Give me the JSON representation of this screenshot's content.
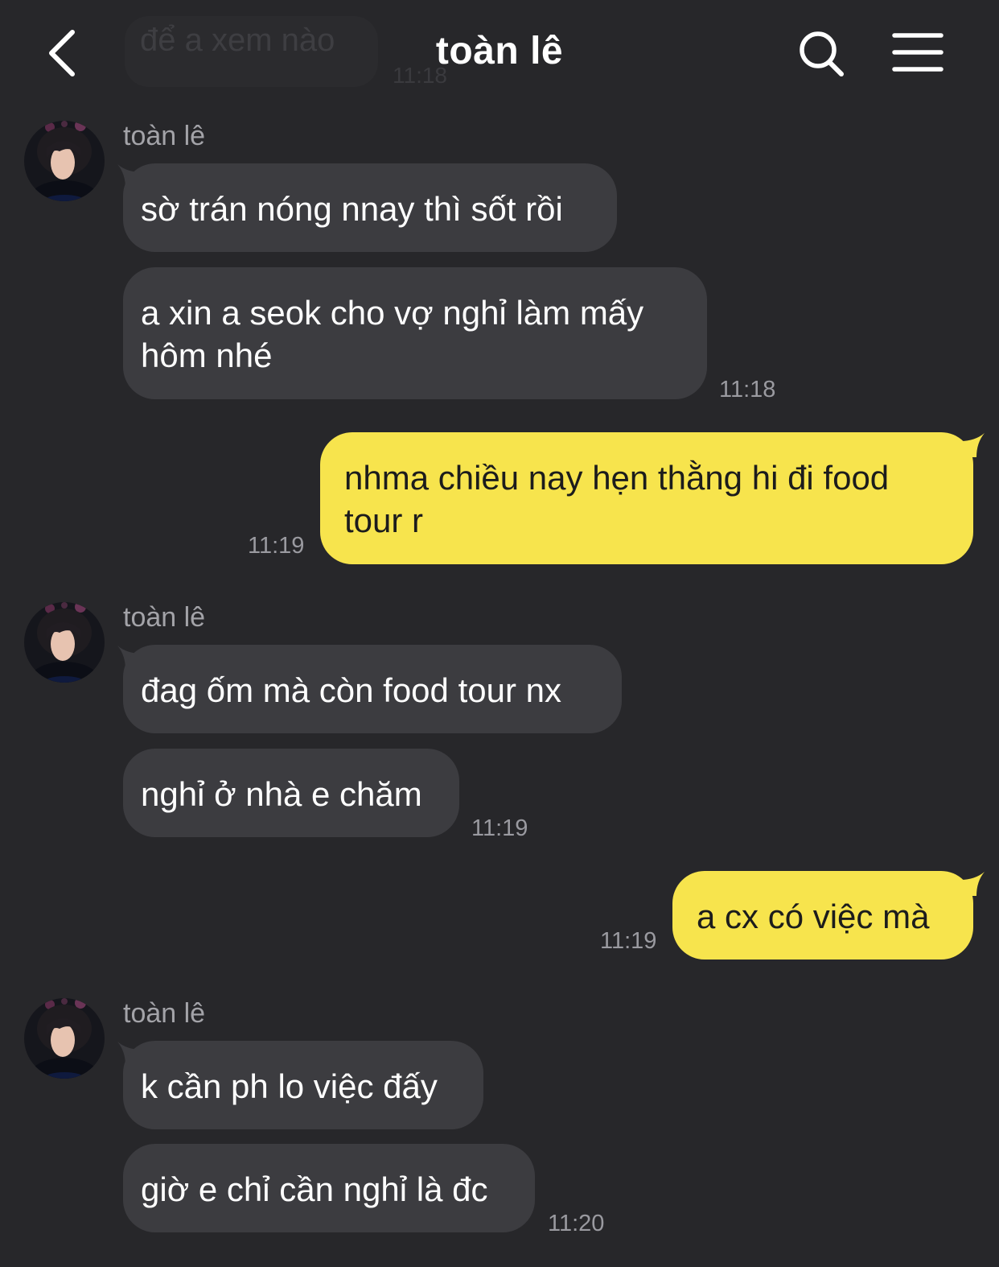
{
  "header": {
    "title": "toàn lê",
    "back_icon": "chevron-left-icon",
    "search_icon": "search-icon",
    "menu_icon": "hamburger-menu-icon"
  },
  "ghost_message": {
    "text": "để a xem nào",
    "time": "11:18"
  },
  "colors": {
    "background": "#27272a",
    "incoming_bubble": "#3c3c40",
    "outgoing_bubble": "#f7e44d",
    "timestamp": "#9a9aa0"
  },
  "groups": [
    {
      "sender": "toàn lê",
      "messages": [
        "sờ trán nóng nnay thì sốt rồi",
        "a xin a seok cho vợ nghỉ làm mấy hôm nhé"
      ],
      "time": "11:18"
    },
    {
      "outgoing": true,
      "messages": [
        "nhma chiều nay hẹn thằng hi đi food tour r"
      ],
      "time": "11:19"
    },
    {
      "sender": "toàn lê",
      "messages": [
        "đag ốm mà còn food tour nx",
        "nghỉ ở nhà e chăm"
      ],
      "time": "11:19"
    },
    {
      "outgoing": true,
      "messages": [
        "a cx có việc mà"
      ],
      "time": "11:19"
    },
    {
      "sender": "toàn lê",
      "messages": [
        "k cần ph lo việc đấy",
        "giờ e chỉ cần nghỉ là đc"
      ],
      "time": "11:20"
    }
  ]
}
